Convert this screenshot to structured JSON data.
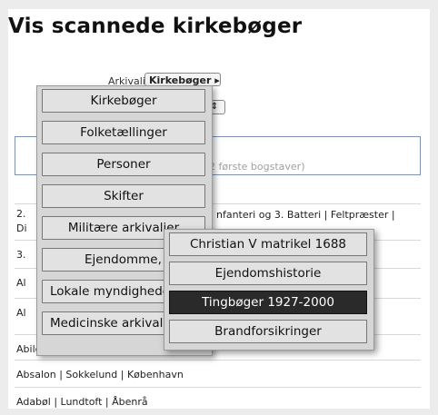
{
  "page": {
    "title": "Vis scannede kirkebøger"
  },
  "filters": {
    "archive_label": "Arkivalie:",
    "archive_value": "Kirkebøger",
    "archive_arrow": "▸",
    "second_select_arrow": "⇕"
  },
  "search": {
    "hint": "2 første bogstaver)"
  },
  "results": [
    {
      "text": "2.",
      "text_b": "nfanteri og 3. Batteri | Feltpræster |",
      "text_c": "Di"
    },
    {
      "text": "3."
    },
    {
      "text": "Al"
    },
    {
      "text": "Al"
    },
    {
      "text": "Abildgård | Horns | Hje"
    },
    {
      "text": "Absalon | Sokkelund | København"
    },
    {
      "text": "Adabøl | Lundtoft | Åbenrå"
    }
  ],
  "menu": {
    "items": [
      "Kirkebøger",
      "Folketællinger",
      "Personer",
      "Skifter",
      "Militære arkivalier",
      "Ejendomme, Landbrug",
      "Lokale myndigheder",
      "Medicinske arkivalier"
    ]
  },
  "submenu": {
    "items": [
      "Christian V matrikel 1688",
      "Ejendomshistorie",
      "Tingbøger 1927-2000",
      "Brandforsikringer"
    ],
    "active_index": 2
  }
}
